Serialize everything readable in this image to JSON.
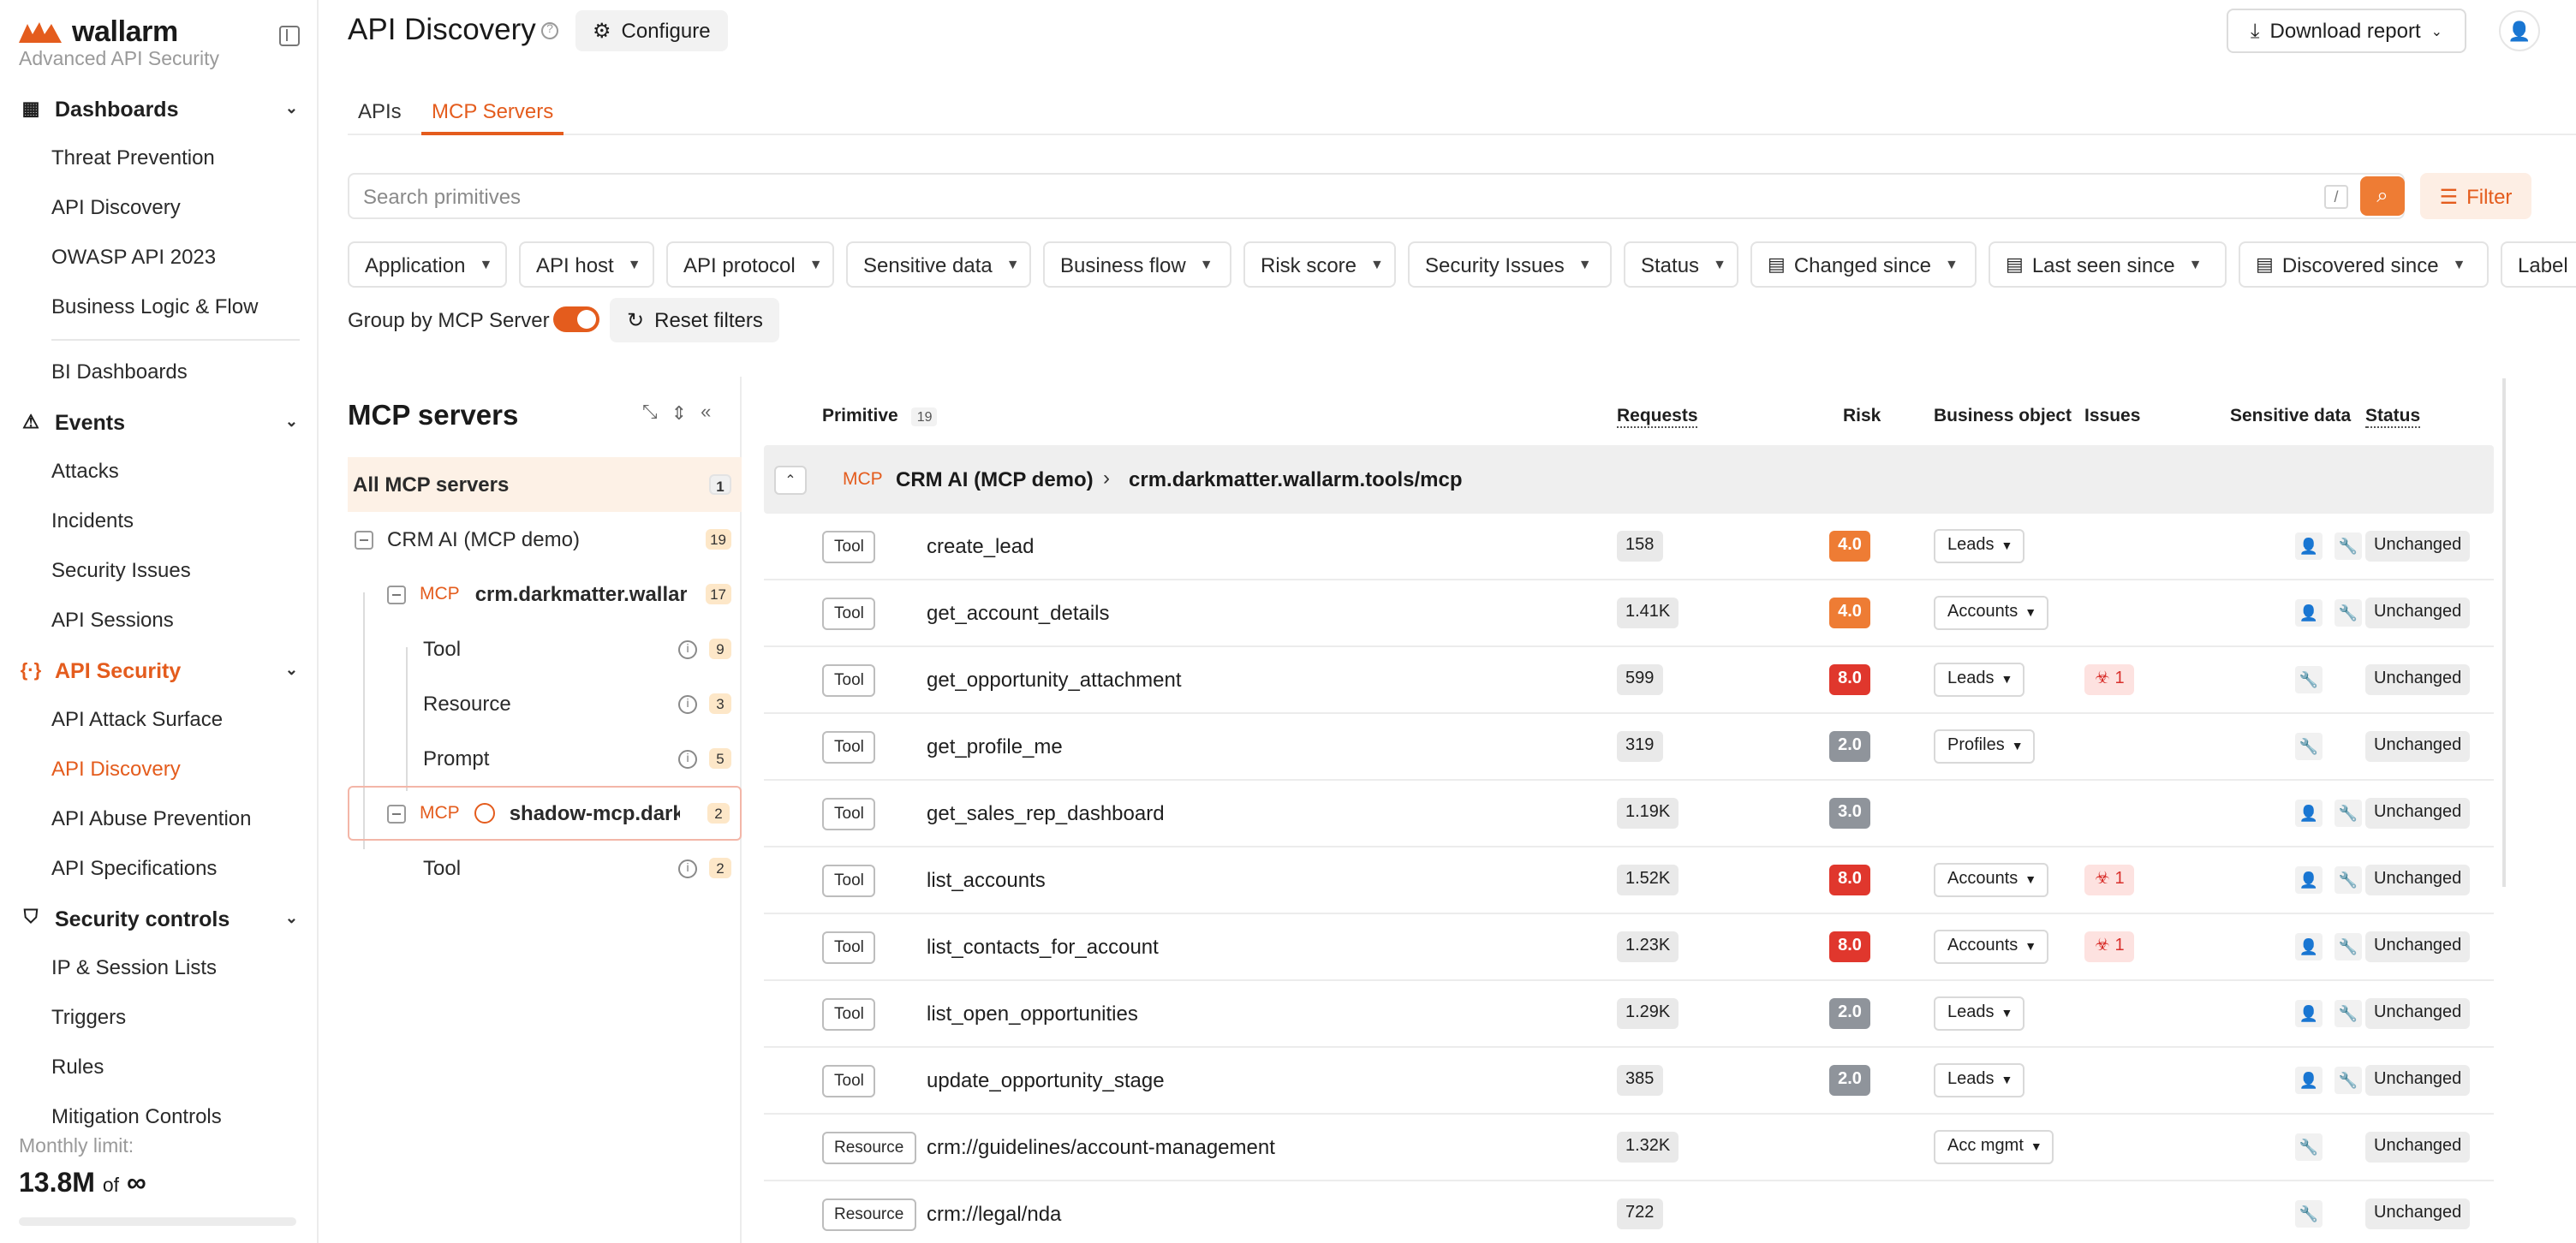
{
  "brand": {
    "name": "wallarm",
    "subtitle": "Advanced API Security"
  },
  "sidebar": {
    "sections": [
      {
        "label": "Dashboards",
        "icon": "grid-icon",
        "items": [
          "Threat Prevention",
          "API Discovery",
          "OWASP API 2023",
          "Business Logic & Flow",
          "BI Dashboards"
        ]
      },
      {
        "label": "Events",
        "icon": "warning-icon",
        "items": [
          "Attacks",
          "Incidents",
          "Security Issues",
          "API Sessions"
        ]
      },
      {
        "label": "API Security",
        "icon": "code-icon",
        "items": [
          "API Attack Surface",
          "API Discovery",
          "API Abuse Prevention",
          "API Specifications"
        ]
      },
      {
        "label": "Security controls",
        "icon": "shield-icon",
        "items": [
          "IP & Session Lists",
          "Triggers",
          "Rules",
          "Mitigation Controls"
        ]
      }
    ],
    "active_item": "API Discovery",
    "limit": {
      "label": "Monthly limit:",
      "value": "13.8M",
      "of": "of",
      "max": "∞",
      "used_fraction": 0
    }
  },
  "header": {
    "title": "API Discovery",
    "configure": "Configure",
    "download": "Download report"
  },
  "tabs": [
    "APIs",
    "MCP Servers"
  ],
  "active_tab": "MCP Servers",
  "search": {
    "placeholder": "Search primitives",
    "shortcut": "/"
  },
  "filter_button": "Filter",
  "filters": [
    "Application",
    "API host",
    "API protocol",
    "Sensitive data",
    "Business flow",
    "Risk score",
    "Security Issues",
    "Status",
    "Changed since",
    "Last seen since",
    "Discovered since",
    "Label"
  ],
  "group_by": {
    "label": "Group by MCP Server",
    "enabled": true
  },
  "reset_filters": "Reset filters",
  "tree": {
    "title": "MCP servers",
    "all_label": "All MCP servers",
    "all_count": "1",
    "nodes": [
      {
        "label": "CRM AI (MCP demo)",
        "count": "19"
      },
      {
        "tag": "MCP",
        "label": "crm.darkmatter.wallarm.tools/mcp",
        "count": "17"
      },
      {
        "label": "Tool",
        "count": "9"
      },
      {
        "label": "Resource",
        "count": "3"
      },
      {
        "label": "Prompt",
        "count": "5"
      },
      {
        "tag": "MCP",
        "label": "shadow-mcp.darkmatter",
        "count": "2"
      },
      {
        "label": "Tool",
        "count": "2"
      }
    ]
  },
  "table": {
    "columns": {
      "primitive": "Primitive",
      "primitive_count": "19",
      "requests": "Requests",
      "risk": "Risk",
      "business_object": "Business object",
      "issues": "Issues",
      "sensitive": "Sensitive data",
      "status": "Status"
    },
    "group": {
      "tag": "MCP",
      "name": "CRM AI (MCP demo)",
      "separator": "›",
      "host": "crm.darkmatter.wallarm.tools/mcp"
    },
    "rows": [
      {
        "type": "Tool",
        "name": "create_lead",
        "requests": "158",
        "risk": "4.0",
        "risk_color": "#ee7c34",
        "object": "Leads",
        "issues": "",
        "sens": 2,
        "status": "Unchanged"
      },
      {
        "type": "Tool",
        "name": "get_account_details",
        "requests": "1.41K",
        "risk": "4.0",
        "risk_color": "#ee7c34",
        "object": "Accounts",
        "issues": "",
        "sens": 2,
        "status": "Unchanged"
      },
      {
        "type": "Tool",
        "name": "get_opportunity_attachment",
        "requests": "599",
        "risk": "8.0",
        "risk_color": "#e0372d",
        "object": "Leads",
        "issues": "1",
        "sens": 1,
        "status": "Unchanged"
      },
      {
        "type": "Tool",
        "name": "get_profile_me",
        "requests": "319",
        "risk": "2.0",
        "risk_color": "#8f949b",
        "object": "Profiles",
        "issues": "",
        "sens": 1,
        "status": "Unchanged"
      },
      {
        "type": "Tool",
        "name": "get_sales_rep_dashboard",
        "requests": "1.19K",
        "risk": "3.0",
        "risk_color": "#8f949b",
        "object": "",
        "issues": "",
        "sens": 2,
        "status": "Unchanged"
      },
      {
        "type": "Tool",
        "name": "list_accounts",
        "requests": "1.52K",
        "risk": "8.0",
        "risk_color": "#e0372d",
        "object": "Accounts",
        "issues": "1",
        "sens": 2,
        "status": "Unchanged"
      },
      {
        "type": "Tool",
        "name": "list_contacts_for_account",
        "requests": "1.23K",
        "risk": "8.0",
        "risk_color": "#e0372d",
        "object": "Accounts",
        "issues": "1",
        "sens": 2,
        "status": "Unchanged"
      },
      {
        "type": "Tool",
        "name": "list_open_opportunities",
        "requests": "1.29K",
        "risk": "2.0",
        "risk_color": "#8f949b",
        "object": "Leads",
        "issues": "",
        "sens": 2,
        "status": "Unchanged"
      },
      {
        "type": "Tool",
        "name": "update_opportunity_stage",
        "requests": "385",
        "risk": "2.0",
        "risk_color": "#8f949b",
        "object": "Leads",
        "issues": "",
        "sens": 2,
        "status": "Unchanged"
      },
      {
        "type": "Resource",
        "name": "crm://guidelines/account-management",
        "requests": "1.32K",
        "risk": "",
        "risk_color": "",
        "object": "Acc mgmt",
        "issues": "",
        "sens": 1,
        "status": "Unchanged"
      },
      {
        "type": "Resource",
        "name": "crm://legal/nda",
        "requests": "722",
        "risk": "",
        "risk_color": "",
        "object": "",
        "issues": "",
        "sens": 1,
        "status": "Unchanged"
      }
    ]
  },
  "colors": {
    "accent": "#e45c1d",
    "risk_high": "#e0372d",
    "risk_medium": "#ee7c34",
    "risk_low": "#8f949b"
  }
}
